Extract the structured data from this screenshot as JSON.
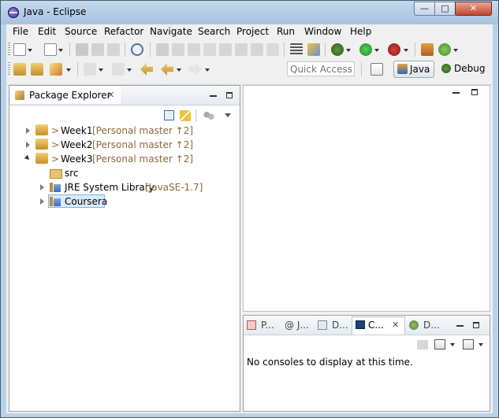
{
  "window": {
    "title": "Java - Eclipse",
    "min_label": "—",
    "max_label": "□",
    "close_label": "✕"
  },
  "menubar": {
    "items": [
      {
        "label": "File"
      },
      {
        "label": "Edit"
      },
      {
        "label": "Source"
      },
      {
        "label": "Refactor"
      },
      {
        "label": "Navigate"
      },
      {
        "label": "Search"
      },
      {
        "label": "Project"
      },
      {
        "label": "Run"
      },
      {
        "label": "Window"
      },
      {
        "label": "Help"
      }
    ]
  },
  "toolbar": {
    "quick_access_placeholder": "Quick Access",
    "perspectives": [
      {
        "label": "Java",
        "active": true
      },
      {
        "label": "Debug",
        "active": false
      }
    ]
  },
  "package_explorer": {
    "tab_label": "Package Explorer",
    "close_glyph": "✕",
    "tree": [
      {
        "prefix": "> ",
        "name": "Week1",
        "decoration": "[Personal master ↑2]",
        "expanded": false,
        "level": 0
      },
      {
        "prefix": "> ",
        "name": "Week2",
        "decoration": "[Personal master ↑2]",
        "expanded": false,
        "level": 0
      },
      {
        "prefix": "> ",
        "name": "Week3",
        "decoration": "[Personal master ↑2]",
        "expanded": true,
        "level": 0
      },
      {
        "prefix": "",
        "name": "src",
        "decoration": "",
        "expanded": false,
        "level": 1
      },
      {
        "prefix": "",
        "name": "JRE System Library",
        "decoration": "[JavaSE-1.7]",
        "expanded": false,
        "level": 1
      },
      {
        "prefix": "",
        "name": "Coursera",
        "decoration": "",
        "expanded": false,
        "level": 1,
        "selected": true
      }
    ]
  },
  "console_view": {
    "tabs": [
      {
        "label": "P..."
      },
      {
        "label": "@ J..."
      },
      {
        "label": "D..."
      },
      {
        "label": "C...",
        "active": true
      },
      {
        "label": "D..."
      }
    ],
    "close_glyph": "✕",
    "message": "No consoles to display at this time."
  },
  "colors": {
    "title_bar": "#b9d1ea",
    "accent_blue": "#3399ff",
    "decoration_text": "#8a6a3a"
  }
}
